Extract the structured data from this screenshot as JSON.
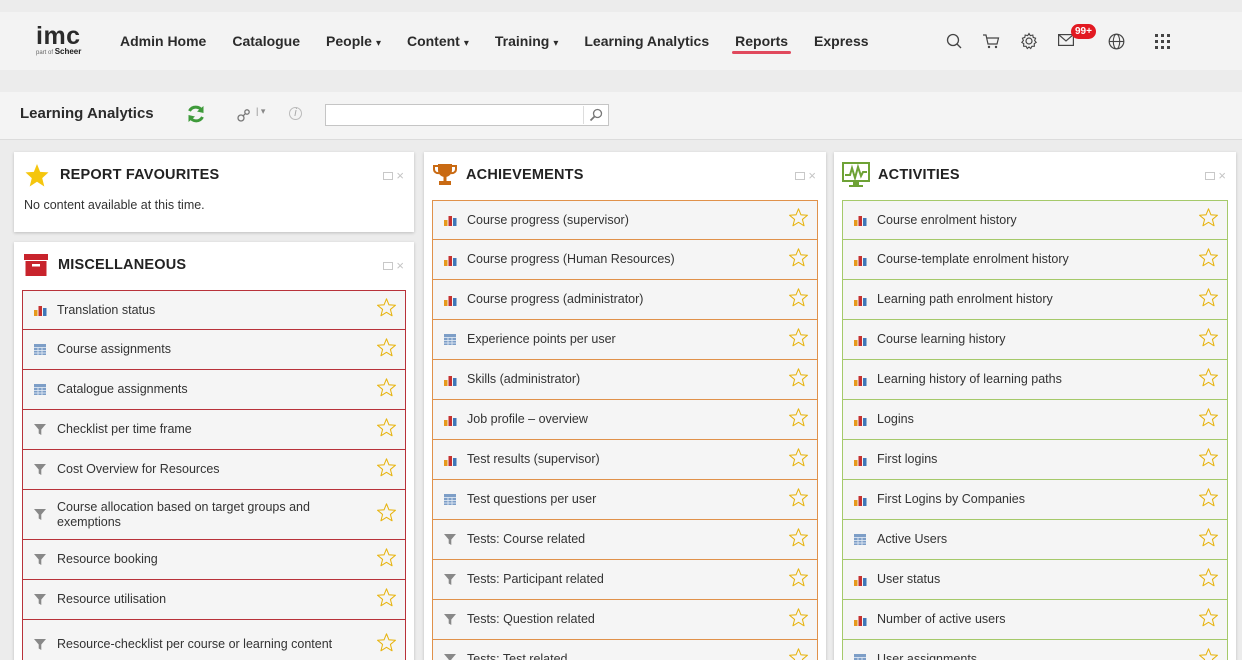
{
  "colors": {
    "accent_red": "#e0485c",
    "misc_border": "#b8323a",
    "achievements_border": "#e0914a",
    "activities_border": "#a5c96a",
    "badge": "#e21a22"
  },
  "logo": {
    "main": "imc",
    "sub_prefix": "part of",
    "sub_brand": "Scheer"
  },
  "nav": {
    "items": [
      {
        "label": "Admin Home",
        "dropdown": false
      },
      {
        "label": "Catalogue",
        "dropdown": false
      },
      {
        "label": "People",
        "dropdown": true
      },
      {
        "label": "Content",
        "dropdown": true
      },
      {
        "label": "Training",
        "dropdown": true
      },
      {
        "label": "Learning Analytics",
        "dropdown": false
      },
      {
        "label": "Reports",
        "dropdown": false,
        "active": true
      },
      {
        "label": "Express",
        "dropdown": false
      }
    ],
    "icons": [
      "search-icon",
      "cart-icon",
      "settings-icon",
      "mail-icon",
      "globe-icon",
      "apps-grid-icon"
    ],
    "mail_badge": "99+"
  },
  "subheader": {
    "title": "Learning Analytics",
    "search": {
      "value": "",
      "placeholder": ""
    }
  },
  "panels": {
    "favourites": {
      "title": "REPORT FAVOURITES",
      "empty_text": "No content available at this time."
    },
    "misc": {
      "title": "MISCELLANEOUS",
      "items": [
        {
          "label": "Translation status",
          "icon": "chart"
        },
        {
          "label": "Course assignments",
          "icon": "table"
        },
        {
          "label": "Catalogue assignments",
          "icon": "table"
        },
        {
          "label": "Checklist per time frame",
          "icon": "filter"
        },
        {
          "label": "Cost Overview for Resources",
          "icon": "filter"
        },
        {
          "label": "Course allocation based on target groups and exemptions",
          "icon": "filter"
        },
        {
          "label": "Resource booking",
          "icon": "filter"
        },
        {
          "label": "Resource utilisation",
          "icon": "filter"
        },
        {
          "label": "Resource-checklist per course or learning content",
          "icon": "filter"
        }
      ]
    },
    "achievements": {
      "title": "ACHIEVEMENTS",
      "items": [
        {
          "label": "Course progress (supervisor)",
          "icon": "chart"
        },
        {
          "label": "Course progress (Human Resources)",
          "icon": "chart"
        },
        {
          "label": "Course progress (administrator)",
          "icon": "chart"
        },
        {
          "label": "Experience points per user",
          "icon": "table"
        },
        {
          "label": "Skills (administrator)",
          "icon": "chart"
        },
        {
          "label": "Job profile – overview",
          "icon": "chart"
        },
        {
          "label": "Test results (supervisor)",
          "icon": "chart"
        },
        {
          "label": "Test questions per user",
          "icon": "table"
        },
        {
          "label": "Tests: Course related",
          "icon": "filter"
        },
        {
          "label": "Tests: Participant related",
          "icon": "filter"
        },
        {
          "label": "Tests: Question related",
          "icon": "filter"
        },
        {
          "label": "Tests: Test related",
          "icon": "filter"
        }
      ]
    },
    "activities": {
      "title": "ACTIVITIES",
      "items": [
        {
          "label": "Course enrolment history",
          "icon": "chart"
        },
        {
          "label": "Course-template enrolment history",
          "icon": "chart"
        },
        {
          "label": "Learning path enrolment history",
          "icon": "chart"
        },
        {
          "label": "Course learning history",
          "icon": "chart"
        },
        {
          "label": "Learning history of learning paths",
          "icon": "chart"
        },
        {
          "label": "Logins",
          "icon": "chart"
        },
        {
          "label": "First logins",
          "icon": "chart"
        },
        {
          "label": "First Logins by Companies",
          "icon": "chart"
        },
        {
          "label": "Active Users",
          "icon": "table"
        },
        {
          "label": "User status",
          "icon": "chart"
        },
        {
          "label": "Number of active users",
          "icon": "chart"
        },
        {
          "label": "User assignments",
          "icon": "table"
        }
      ]
    }
  }
}
